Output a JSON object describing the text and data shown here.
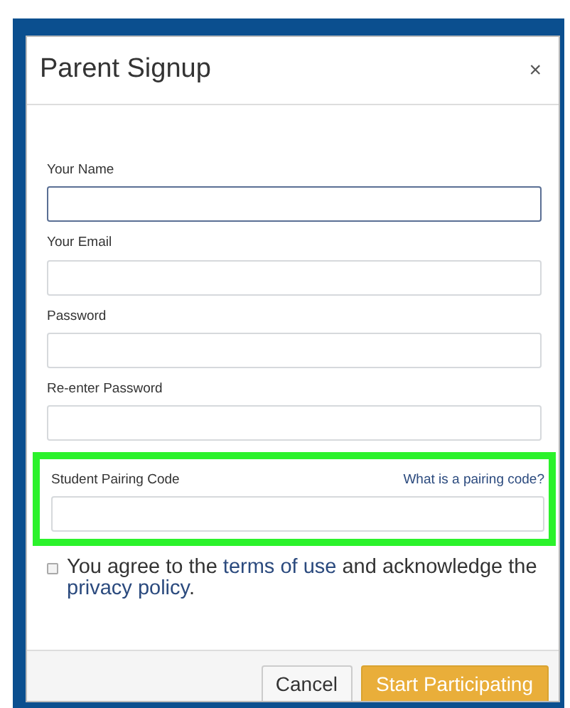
{
  "dialog": {
    "title": "Parent Signup",
    "close": "×"
  },
  "fields": [
    {
      "label": "Your Name",
      "focused": true,
      "highlighted": false
    },
    {
      "label": "Your Email",
      "focused": false,
      "highlighted": false
    },
    {
      "label": "Password",
      "focused": false,
      "highlighted": false
    },
    {
      "label": "Re-enter Password",
      "focused": false,
      "highlighted": false
    },
    {
      "label": "Student Pairing Code",
      "focused": false,
      "highlighted": true,
      "help_link": "What is a pairing code?"
    }
  ],
  "agreement": {
    "checked": false,
    "parts": [
      {
        "kind": "text",
        "text": "You agree to the"
      },
      {
        "kind": "link",
        "text": "terms of use"
      },
      {
        "kind": "text",
        "text": "and acknowledge the"
      },
      {
        "kind": "link",
        "text": "privacy policy"
      },
      {
        "kind": "text",
        "text": "."
      }
    ]
  },
  "buttons": [
    {
      "label": "Cancel",
      "kind": "secondary"
    },
    {
      "label": "Start Participating",
      "kind": "primary"
    }
  ]
}
